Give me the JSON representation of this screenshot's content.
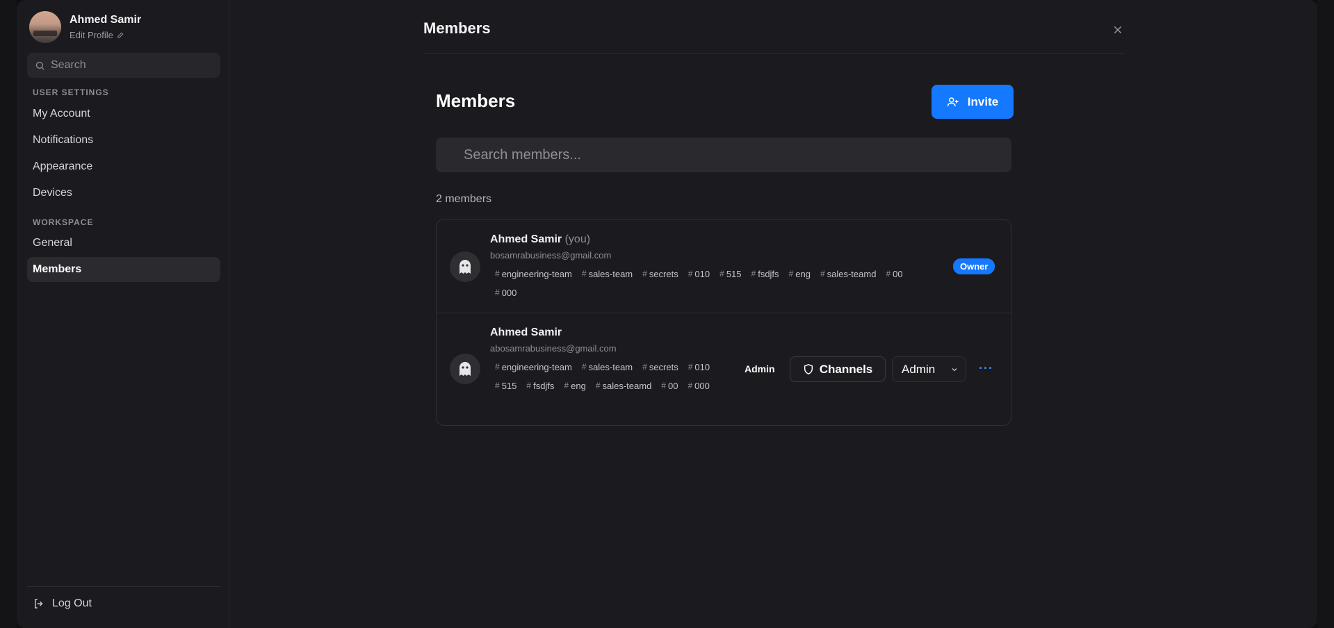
{
  "profile": {
    "name": "Ahmed Samir",
    "edit_label": "Edit Profile"
  },
  "sidebar": {
    "search_placeholder": "Search",
    "user_settings_label": "USER SETTINGS",
    "user_items": [
      "My Account",
      "Notifications",
      "Appearance",
      "Devices"
    ],
    "workspace_label": "WORKSPACE",
    "workspace_items": [
      "General",
      "Members"
    ],
    "active_item": "Members",
    "logout_label": "Log Out"
  },
  "header": {
    "title": "Members"
  },
  "content": {
    "title": "Members",
    "invite_label": "Invite",
    "search_placeholder": "Search members...",
    "count_label": "2 members"
  },
  "members": [
    {
      "name": "Ahmed Samir",
      "you_label": "(you)",
      "email": "bosamrabusiness@gmail.com",
      "tags": [
        "engineering-team",
        "sales-team",
        "secrets",
        "010",
        "515",
        "fsdjfs",
        "eng",
        "sales-teamd",
        "00",
        "000"
      ],
      "badge": "Owner"
    },
    {
      "name": "Ahmed Samir",
      "email": "abosamrabusiness@gmail.com",
      "tags": [
        "engineering-team",
        "sales-team",
        "secrets",
        "010",
        "515",
        "fsdjfs",
        "eng",
        "sales-teamd",
        "00",
        "000"
      ],
      "role_label": "Admin",
      "channels_label": "Channels",
      "role_select_value": "Admin",
      "more_label": "···"
    }
  ],
  "colors": {
    "accent": "#1479ff",
    "background": "#1b1b1f",
    "surface": "#29292e"
  }
}
